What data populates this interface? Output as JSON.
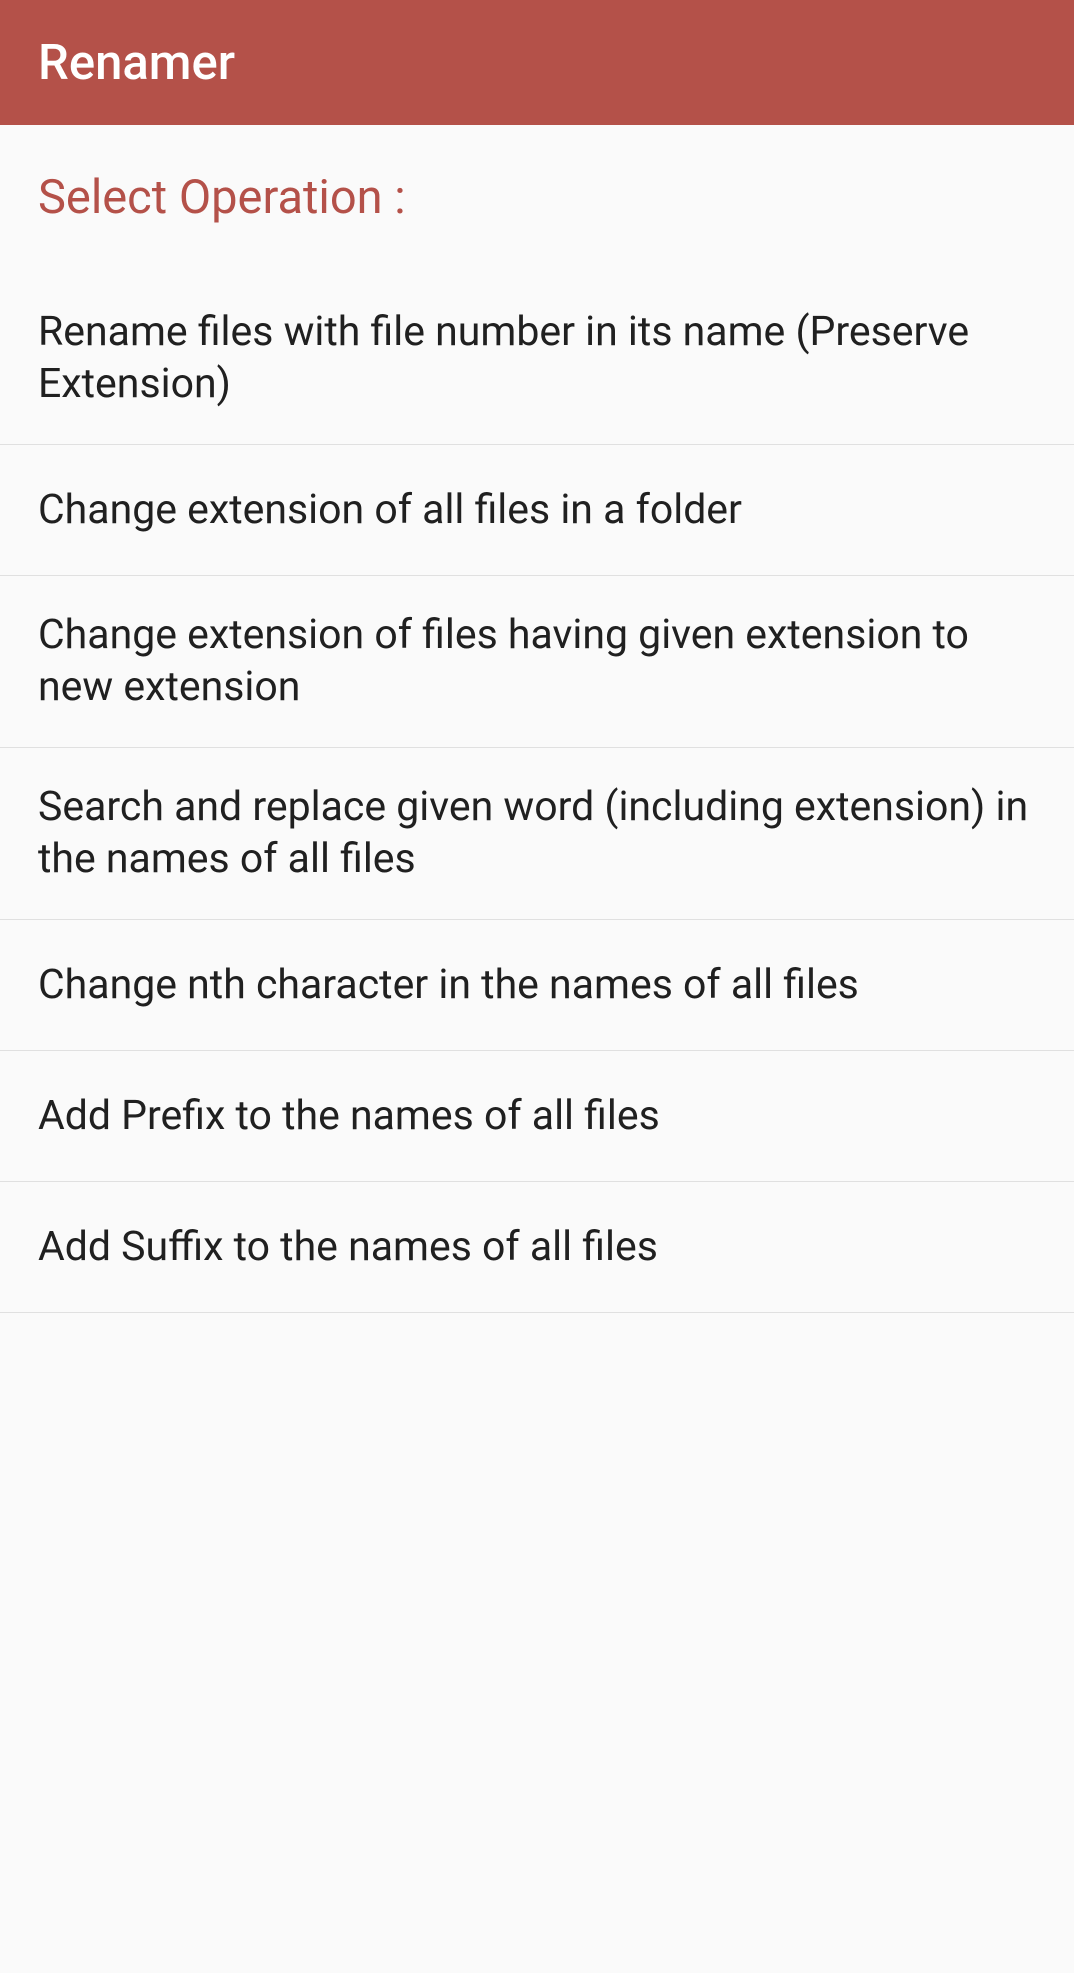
{
  "header": {
    "title": "Renamer"
  },
  "section": {
    "label": "Select Operation :"
  },
  "operations": [
    {
      "label": "Rename files with file number in its name (Preserve Extension)"
    },
    {
      "label": "Change extension of all files in a folder"
    },
    {
      "label": "Change extension of files having given extension to new extension"
    },
    {
      "label": "Search and replace given word (including extension) in the names of all files"
    },
    {
      "label": "Change nth character in the names of all files"
    },
    {
      "label": "Add Prefix to the names of all files"
    },
    {
      "label": "Add Suffix to the names of all files"
    }
  ]
}
